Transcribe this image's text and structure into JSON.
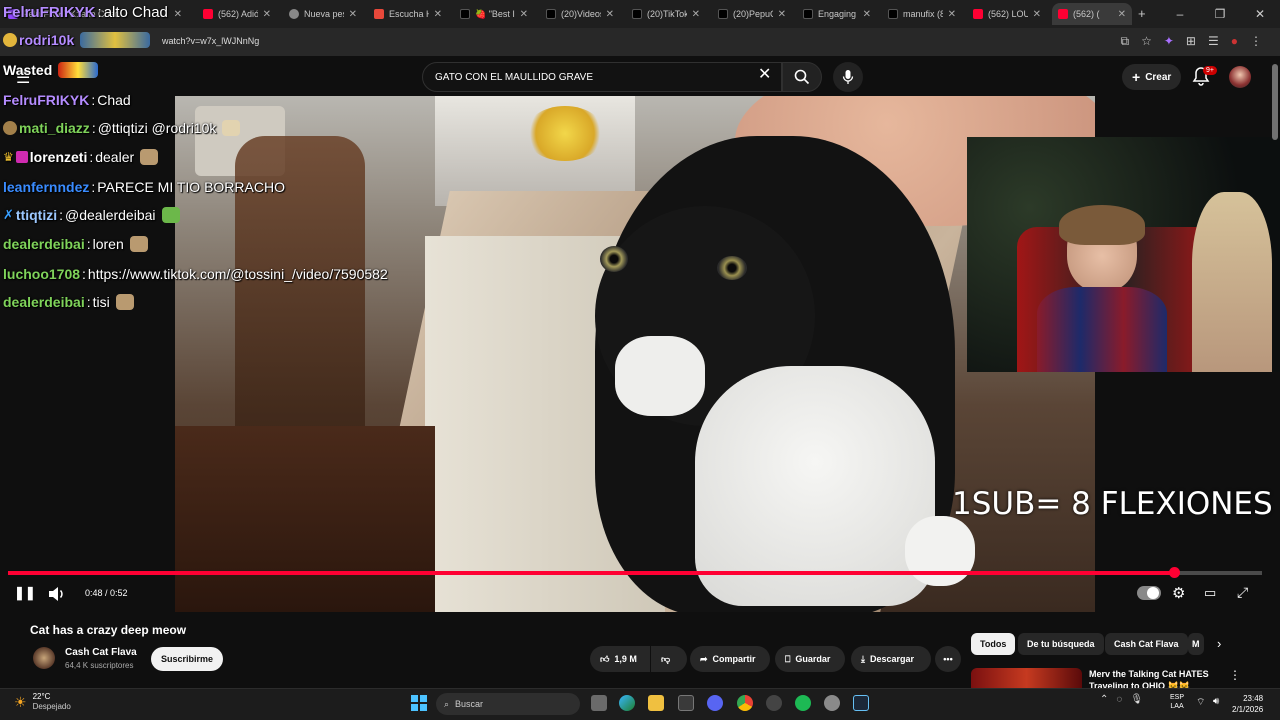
{
  "browser": {
    "tabs": [
      {
        "title": "FelruFRIKYK: alto Chad",
        "icon": "game-icon",
        "color": "#9147ff"
      },
      {
        "title": "(562) Adió",
        "icon": "youtube-icon",
        "color": "#ff0033"
      },
      {
        "title": "Nueva pes",
        "icon": "globe-icon",
        "color": "#888888"
      },
      {
        "title": "Escucha H",
        "icon": "music-icon",
        "color": "#e8483a"
      },
      {
        "title": "🍓 \"Best I",
        "icon": "tiktok-icon",
        "color": "#111111"
      },
      {
        "title": "(20)Videos",
        "icon": "tiktok-icon",
        "color": "#111111"
      },
      {
        "title": "(20)TikTok",
        "icon": "tiktok-icon",
        "color": "#111111"
      },
      {
        "title": "(20)PepuC",
        "icon": "tiktok-icon",
        "color": "#111111"
      },
      {
        "title": "Engaging",
        "icon": "tiktok-icon",
        "color": "#111111"
      },
      {
        "title": "manufix (8",
        "icon": "tiktok-icon",
        "color": "#111111"
      },
      {
        "title": "(562) LOU",
        "icon": "youtube-icon",
        "color": "#ff0033"
      },
      {
        "title": "(562) (",
        "icon": "youtube-icon",
        "color": "#ff0033"
      }
    ],
    "new_tab": "+",
    "url": "watch?v=w7x_lWJNnNg"
  },
  "youtube": {
    "search_query": "GATO CON EL MAULLIDO GRAVE",
    "create_label": "Crear",
    "notification_count": "9+",
    "video": {
      "title": "Cat has a crazy deep meow",
      "time": "0:48 / 0:52",
      "progress": 0.93
    },
    "channel": {
      "name": "Cash Cat Flava",
      "subscribers": "64,4 K suscriptores",
      "subscribe_label": "Suscribirme"
    },
    "actions": {
      "likes": "1,9 M",
      "share": "Compartir",
      "save": "Guardar",
      "download": "Descargar"
    },
    "chips": [
      "Todos",
      "De tu búsqueda",
      "Cash Cat Flava",
      "M"
    ],
    "recommendation": {
      "title": "Merv the Talking Cat HATES Traveling to OHIO 😺😺"
    }
  },
  "stream_overlay": {
    "logo_text": "Wasted",
    "sub_goal": "1SUB= 8 FLEXIONES",
    "chat": [
      {
        "user": "FelruFRIKYK",
        "sep": ": ",
        "message": "alto Chad",
        "color": "#b58cff"
      },
      {
        "user": "rodri10k",
        "sep": "",
        "message": "",
        "color": "#b58cff"
      },
      {
        "user": "Wasted",
        "sep": "",
        "message": "",
        "color": "#ffffff"
      },
      {
        "user": "FelruFRIKYK",
        "sep": ": ",
        "message": "Chad",
        "color": "#b58cff"
      },
      {
        "user": "mati_diazz",
        "sep": ": ",
        "message": "@ttiqtizi @rodri10k",
        "color": "#7fd35a"
      },
      {
        "user": "lorenzeti",
        "sep": ": ",
        "message": "dealer",
        "color": "#ffffff"
      },
      {
        "user": "leanfernndez",
        "sep": ": ",
        "message": "PARECE MI TIO BORRACHO",
        "color": "#3a8cff"
      },
      {
        "user": "ttiqtizi",
        "sep": ": ",
        "message": "@dealerdeibai",
        "color": "#9cc8ff"
      },
      {
        "user": "dealerdeibai",
        "sep": ": ",
        "message": "loren",
        "color": "#7fd35a"
      },
      {
        "user": "luchoo1708",
        "sep": ": ",
        "message": "https://www.tiktok.com/@tossini_/video/7590582",
        "color": "#7fd35a"
      },
      {
        "user": "dealerdeibai",
        "sep": ": ",
        "message": "tisi",
        "color": "#7fd35a"
      }
    ]
  },
  "taskbar": {
    "weather_temp": "22°C",
    "weather_desc": "Despejado",
    "search_label": "Buscar",
    "lang_top": "ESP",
    "lang_bottom": "LAA",
    "time": "23:48",
    "date": "2/1/2026"
  }
}
